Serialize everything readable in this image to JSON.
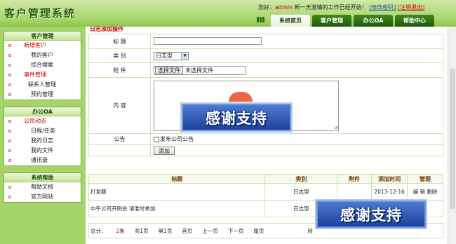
{
  "header": {
    "app_title": "客户管理系统",
    "greeting_prefix": "您好：",
    "username": "admin",
    "greeting_suffix": " 新一天激情的工作已经开始！",
    "change_password": "[修改密码]",
    "logout": "[注销退出]",
    "tabs": [
      {
        "label": "系统首页",
        "active": true
      },
      {
        "label": "客户管理",
        "active": false
      },
      {
        "label": "办公OA",
        "active": false
      },
      {
        "label": "帮助中心",
        "active": false
      }
    ]
  },
  "sidebar": {
    "groups": [
      {
        "title": "客户管理",
        "items": [
          {
            "label": "新增客户",
            "type": "category"
          },
          {
            "label": "我的客户",
            "type": "link"
          },
          {
            "label": "综合搜索",
            "type": "link"
          },
          {
            "label": "事件管理",
            "type": "category"
          },
          {
            "label": "联系人管理",
            "type": "link"
          },
          {
            "label": "预约管理",
            "type": "link"
          }
        ]
      },
      {
        "title": "办公OA",
        "items": [
          {
            "label": "公司动态",
            "type": "category"
          },
          {
            "label": "日程/任务",
            "type": "link"
          },
          {
            "label": "我的日志",
            "type": "link"
          },
          {
            "label": "我的文件",
            "type": "link"
          },
          {
            "label": "通讯录",
            "type": "link"
          }
        ]
      },
      {
        "title": "系统帮助",
        "items": [
          {
            "label": "帮助文档",
            "type": "link"
          },
          {
            "label": "官方网站",
            "type": "link"
          }
        ]
      }
    ]
  },
  "form": {
    "section_title": "日志添加操作",
    "title_label": "标 题",
    "title_value": "",
    "category_label": "类 别",
    "category_value": "日志型",
    "attachment_label": "附 件",
    "choose_file_button": "选择文件",
    "no_file_text": "未选择文件",
    "content_label": "内 容",
    "content_value": "",
    "notice_label": "公告",
    "publish_checkbox_label": "发布公司公告",
    "publish_checked": false,
    "submit_button": "添加"
  },
  "list": {
    "columns": [
      "标题",
      "类别",
      "附件",
      "添加时间",
      "管理"
    ],
    "rows": [
      {
        "title": "打发额",
        "category": "日志型",
        "attachment": "",
        "date": "2013-12-16",
        "edit": "编 辑",
        "delete": "删除"
      },
      {
        "title": "中午公司开例会 请准时参加",
        "category": "日志型",
        "attachment": "",
        "date": "",
        "edit": "",
        "delete": ""
      }
    ]
  },
  "pager": {
    "total_prefix": "总计：",
    "total_count": "2",
    "total_suffix": "条",
    "pages_text": "共1页",
    "current_page_text": "第1页",
    "first": "首页",
    "prev": "上一页",
    "next": "下一页",
    "last": "尾页",
    "goto_partial": "转"
  },
  "watermarks": [
    "感谢支持",
    "感谢支持"
  ]
}
